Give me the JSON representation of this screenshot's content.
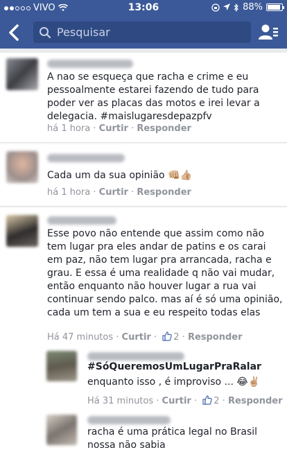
{
  "status_bar": {
    "carrier": "VIVO",
    "time": "13:06",
    "battery": "88%"
  },
  "search": {
    "placeholder": "Pesquisar"
  },
  "comments": [
    {
      "text": "A nao se esqueça que racha e crime e eu pessoalmente estarei fazendo de tudo para poder ver as placas das motos e irei levar a delegacia. #maislugaresdepazpfv",
      "time": "há 1 hora",
      "like_label": "Curtir",
      "reply_label": "Responder"
    },
    {
      "text": "Cada um da sua opinião 👊🏼👍🏼",
      "time": "há 1 hora",
      "like_label": "Curtir",
      "reply_label": "Responder"
    },
    {
      "text": "Esse povo não entende que assim como não tem lugar pra eles andar de patins e os carai em paz, não tem lugar pra arrancada, racha e grau. E essa é uma realidade q não vai mudar, então enquanto não houver lugar a rua vai continuar sendo palco. mas aí é só uma opinião, cada um tem a sua e eu respeito todas elas",
      "time": "Há 47 minutos",
      "like_label": "Curtir",
      "like_count": "2",
      "reply_label": "Responder"
    }
  ],
  "replies": [
    {
      "text_line1": "#SóQueremosUmLugarPraRalar",
      "text_line2": "enquanto isso , é improviso ... 😂✌🏼",
      "time": "Há 31 minutos",
      "like_label": "Curtir",
      "like_count": "2",
      "reply_label": "Responder"
    },
    {
      "text": "racha é uma prática legal no Brasil nossa não sabia"
    }
  ],
  "colors": {
    "header": "#3b5998",
    "search_bg": "#2f4a83",
    "meta": "#90949c"
  }
}
